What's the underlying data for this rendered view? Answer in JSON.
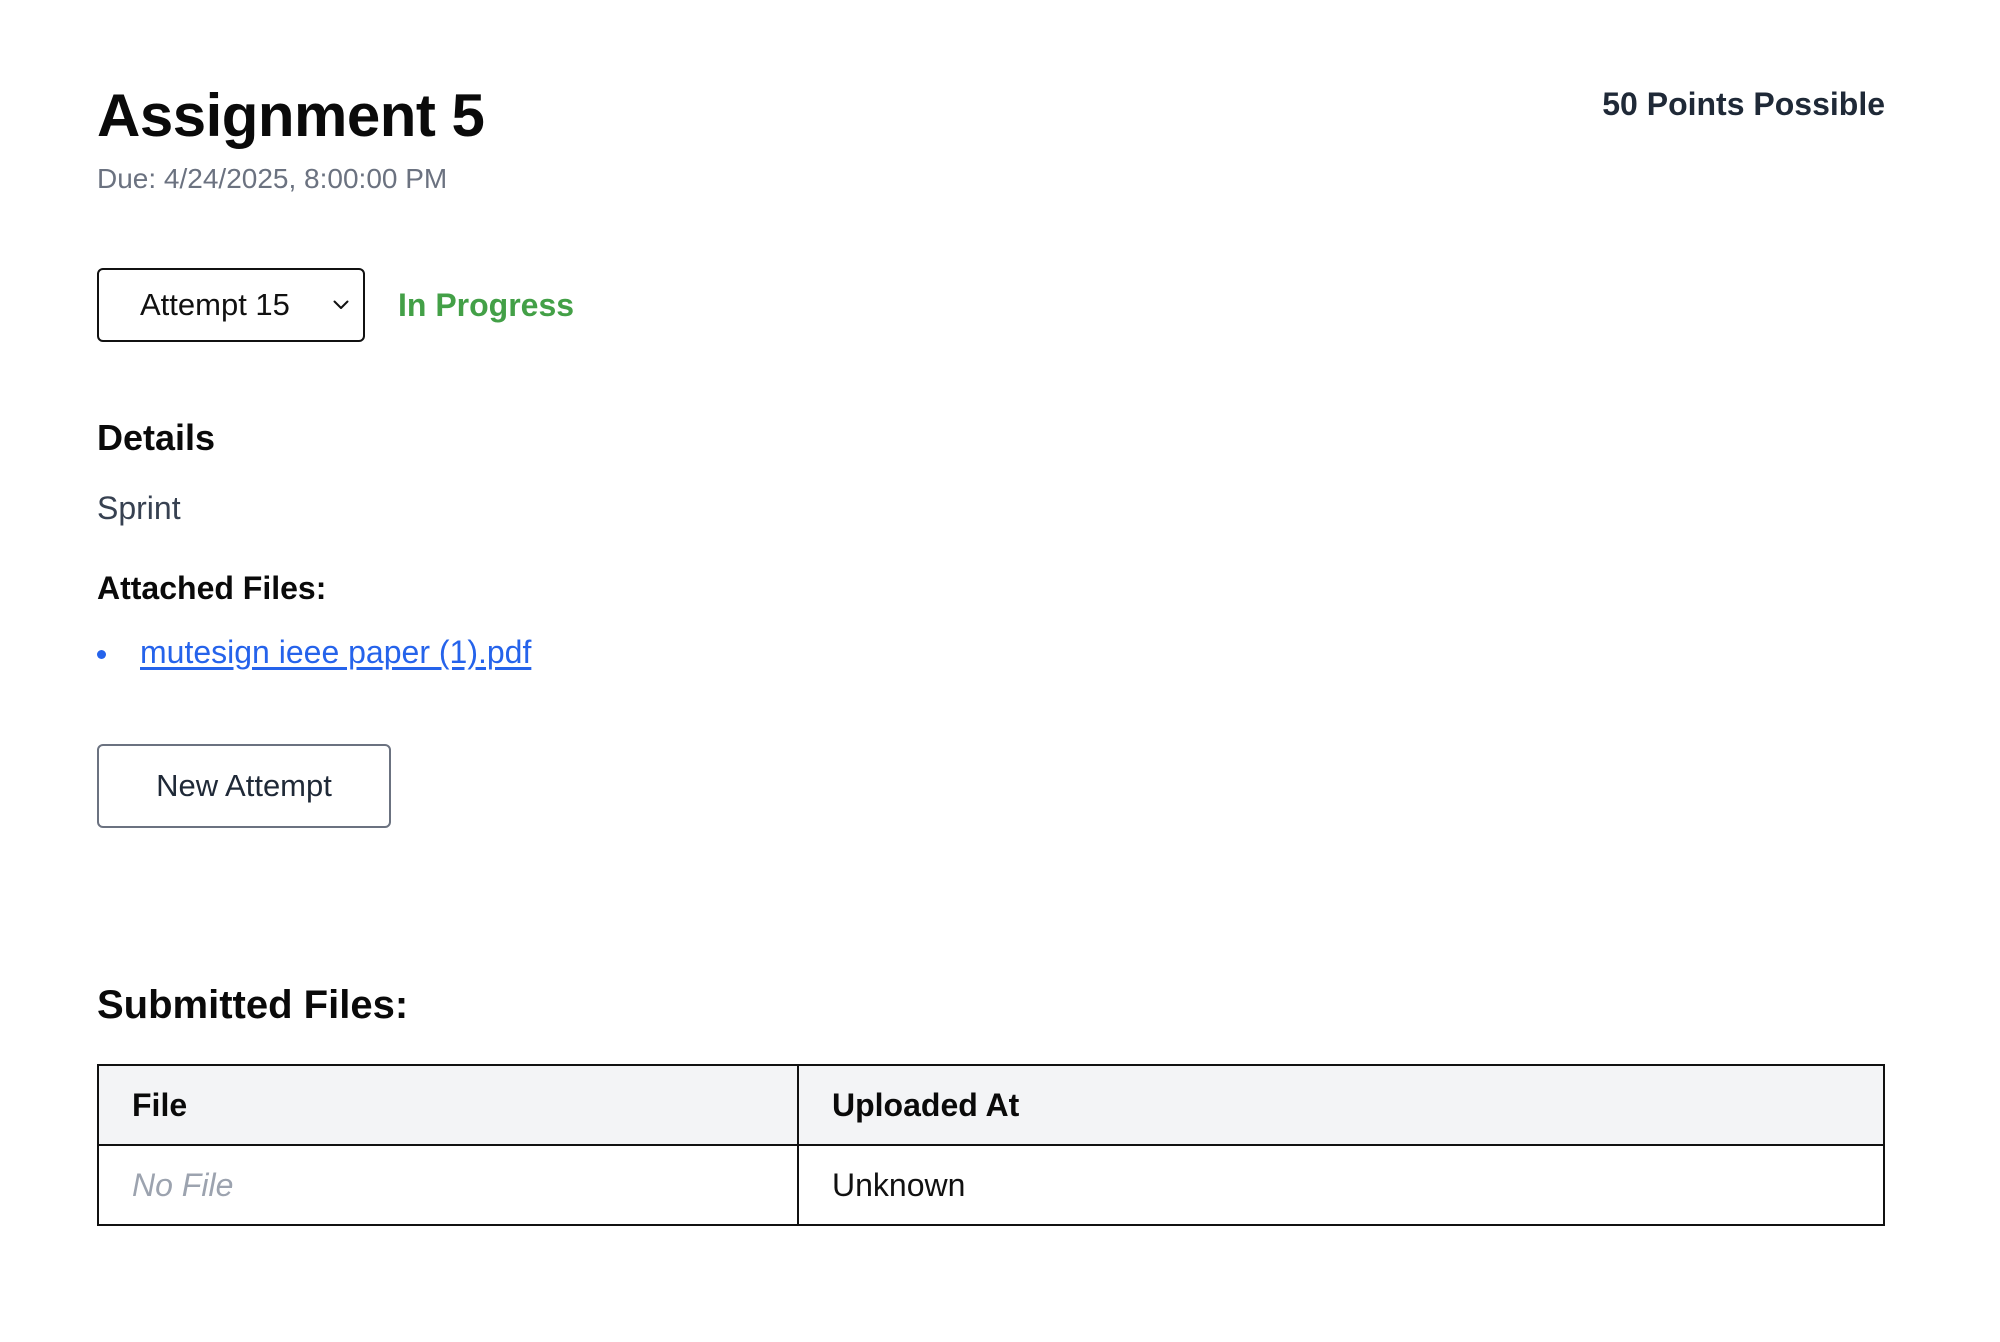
{
  "assignment": {
    "title": "Assignment 5",
    "due": "Due: 4/24/2025, 8:00:00 PM",
    "points": "50 Points Possible"
  },
  "attempt": {
    "selected": "Attempt 15",
    "status": "In Progress",
    "status_color": "#43a047"
  },
  "details": {
    "heading": "Details",
    "text": "Sprint"
  },
  "attached": {
    "heading": "Attached Files:",
    "files": [
      {
        "name": "mutesign ieee paper (1).pdf"
      }
    ]
  },
  "actions": {
    "new_attempt_label": "New Attempt"
  },
  "submitted": {
    "heading": "Submitted Files:",
    "columns": [
      "File",
      "Uploaded At"
    ],
    "rows": [
      {
        "file": "No File",
        "uploaded_at": "Unknown"
      }
    ]
  },
  "colors": {
    "link": "#2563eb",
    "muted": "#6b7280",
    "header_bg": "#f3f4f6"
  },
  "icons": {
    "select_arrow": "chevron-down-icon",
    "list_bullet": "bullet-icon"
  }
}
